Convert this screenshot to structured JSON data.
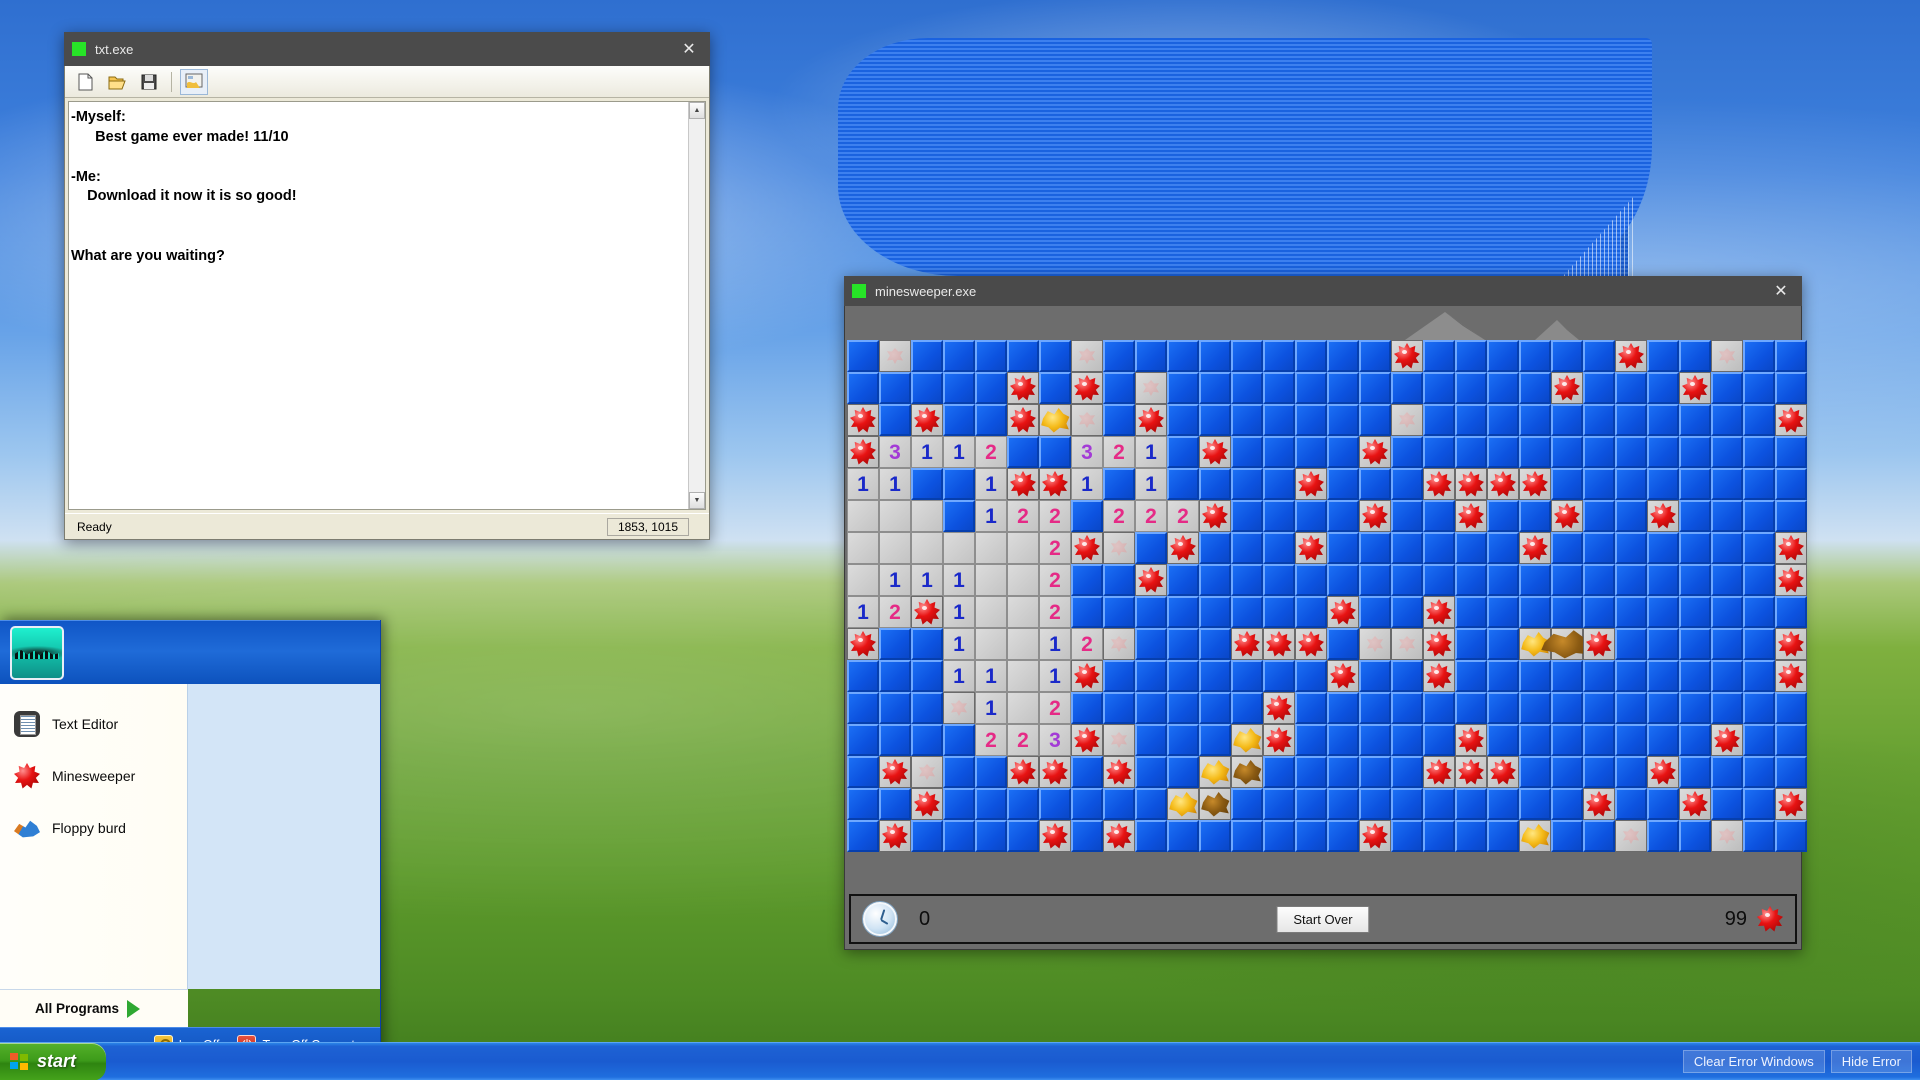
{
  "desktop": {
    "name": "windows-xp-bliss-wallpaper"
  },
  "text_editor": {
    "title": "txt.exe",
    "close_label": "✕",
    "toolbar": [
      {
        "name": "new-file-icon",
        "label": "New"
      },
      {
        "name": "open-file-icon",
        "label": "Open"
      },
      {
        "name": "save-file-icon",
        "label": "Save"
      },
      {
        "name": "run-script-icon",
        "label": "Run"
      }
    ],
    "content": "-Myself:\n      Best game ever made! 11/10\n\n-Me:\n    Download it now it is so good!\n\n\nWhat are you waiting?",
    "status_left": "Ready",
    "status_right": "1853, 1015"
  },
  "minesweeper": {
    "title": "minesweeper.exe",
    "close_label": "✕",
    "timer": "0",
    "mines_remaining": "99",
    "start_over_label": "Start Over",
    "clock_icon": "clock-icon",
    "mine_icon": "mine-icon",
    "grid": {
      "columns": 30,
      "rows": 16,
      "legend": {
        "h": "hidden-blue-tile",
        "o": "opened-empty-tile",
        "m": "revealed-mine",
        "f": "faint-flag-ghost",
        "b": "explosion-blob",
        "d": "dark-explosion-blob",
        "w": "wide-explosion-blob"
      },
      "cells": [
        [
          "h",
          "f",
          "h",
          "h",
          "h",
          "h",
          "h",
          "f",
          "h",
          "h",
          "h",
          "h",
          "h",
          "h",
          "h",
          "h",
          "h",
          "m",
          "h",
          "h",
          "h",
          "h",
          "h",
          "h",
          "m",
          "h",
          "h",
          "f",
          "h",
          "h"
        ],
        [
          "h",
          "h",
          "h",
          "h",
          "h",
          "m",
          "h",
          "m",
          "h",
          "f",
          "h",
          "h",
          "h",
          "h",
          "h",
          "h",
          "h",
          "h",
          "h",
          "h",
          "h",
          "h",
          "m",
          "h",
          "h",
          "h",
          "m",
          "h",
          "h",
          "h"
        ],
        [
          "m",
          "h",
          "m",
          "h",
          "h",
          "m",
          "b",
          "f",
          "h",
          "m",
          "h",
          "h",
          "h",
          "h",
          "h",
          "h",
          "h",
          "f",
          "h",
          "h",
          "h",
          "h",
          "h",
          "h",
          "h",
          "h",
          "h",
          "h",
          "h",
          "m"
        ],
        [
          "m",
          "3",
          "1",
          "1",
          "2",
          "h",
          "h",
          "3",
          "2",
          "1",
          "h",
          "m",
          "h",
          "h",
          "h",
          "h",
          "m",
          "h",
          "h",
          "h",
          "h",
          "h",
          "h",
          "h",
          "h",
          "h",
          "h",
          "h",
          "h",
          "h"
        ],
        [
          "1",
          "1",
          "h",
          "h",
          "1",
          "m",
          "m",
          "1",
          "h",
          "1",
          "h",
          "h",
          "h",
          "h",
          "m",
          "h",
          "h",
          "h",
          "m",
          "m",
          "m",
          "m",
          "h",
          "h",
          "h",
          "h",
          "h",
          "h",
          "h",
          "h"
        ],
        [
          "o",
          "o",
          "o",
          "h",
          "1",
          "2",
          "2",
          "h",
          "2",
          "2",
          "2",
          "m",
          "h",
          "h",
          "h",
          "h",
          "m",
          "h",
          "h",
          "m",
          "h",
          "h",
          "m",
          "h",
          "h",
          "m",
          "h",
          "h",
          "h",
          "h"
        ],
        [
          "o",
          "o",
          "o",
          "o",
          "o",
          "o",
          "2",
          "m",
          "f",
          "h",
          "m",
          "h",
          "h",
          "h",
          "m",
          "h",
          "h",
          "h",
          "h",
          "h",
          "h",
          "m",
          "h",
          "h",
          "h",
          "h",
          "h",
          "h",
          "h",
          "m"
        ],
        [
          "o",
          "1",
          "1",
          "1",
          "o",
          "o",
          "2",
          "h",
          "h",
          "m",
          "h",
          "h",
          "h",
          "h",
          "h",
          "h",
          "h",
          "h",
          "h",
          "h",
          "h",
          "h",
          "h",
          "h",
          "h",
          "h",
          "h",
          "h",
          "h",
          "m"
        ],
        [
          "1",
          "2",
          "m",
          "1",
          "o",
          "o",
          "2",
          "h",
          "h",
          "h",
          "h",
          "h",
          "h",
          "h",
          "h",
          "m",
          "h",
          "h",
          "m",
          "h",
          "h",
          "h",
          "h",
          "h",
          "h",
          "h",
          "h",
          "h",
          "h",
          "h"
        ],
        [
          "m",
          "h",
          "h",
          "1",
          "o",
          "o",
          "1",
          "2",
          "f",
          "h",
          "h",
          "h",
          "m",
          "m",
          "m",
          "h",
          "f",
          "f",
          "m",
          "h",
          "h",
          "b",
          "w",
          "m",
          "h",
          "h",
          "h",
          "h",
          "h",
          "m"
        ],
        [
          "h",
          "h",
          "h",
          "1",
          "1",
          "o",
          "1",
          "m",
          "h",
          "h",
          "h",
          "h",
          "h",
          "h",
          "h",
          "m",
          "h",
          "h",
          "m",
          "h",
          "h",
          "h",
          "h",
          "h",
          "h",
          "h",
          "h",
          "h",
          "h",
          "m"
        ],
        [
          "h",
          "h",
          "h",
          "f",
          "1",
          "o",
          "2",
          "h",
          "h",
          "h",
          "h",
          "h",
          "h",
          "m",
          "h",
          "h",
          "h",
          "h",
          "h",
          "h",
          "h",
          "h",
          "h",
          "h",
          "h",
          "h",
          "h",
          "h",
          "h",
          "h"
        ],
        [
          "h",
          "h",
          "h",
          "h",
          "2",
          "2",
          "3",
          "m",
          "f",
          "h",
          "h",
          "h",
          "b",
          "m",
          "h",
          "h",
          "h",
          "h",
          "h",
          "m",
          "h",
          "h",
          "h",
          "h",
          "h",
          "h",
          "h",
          "m",
          "h",
          "h"
        ],
        [
          "h",
          "m",
          "f",
          "h",
          "h",
          "m",
          "m",
          "h",
          "m",
          "h",
          "h",
          "b",
          "d",
          "h",
          "h",
          "h",
          "h",
          "h",
          "m",
          "m",
          "m",
          "h",
          "h",
          "h",
          "h",
          "m",
          "h",
          "h",
          "h",
          "h"
        ],
        [
          "h",
          "h",
          "m",
          "h",
          "h",
          "h",
          "h",
          "h",
          "h",
          "h",
          "b",
          "d",
          "h",
          "h",
          "h",
          "h",
          "h",
          "h",
          "h",
          "h",
          "h",
          "h",
          "h",
          "m",
          "h",
          "h",
          "m",
          "h",
          "h",
          "m"
        ],
        [
          "h",
          "m",
          "h",
          "h",
          "h",
          "h",
          "m",
          "h",
          "m",
          "h",
          "h",
          "h",
          "h",
          "h",
          "h",
          "h",
          "m",
          "h",
          "h",
          "h",
          "h",
          "b",
          "h",
          "h",
          "f",
          "h",
          "h",
          "f",
          "h",
          "h"
        ]
      ]
    }
  },
  "start_menu": {
    "avatar_name": "user-avatar",
    "items": [
      {
        "label": "Text Editor",
        "icon": "text-document-icon"
      },
      {
        "label": "Minesweeper",
        "icon": "mine-icon"
      },
      {
        "label": "Floppy burd",
        "icon": "bird-icon"
      }
    ],
    "all_programs_label": "All Programs",
    "log_off_label": "Log Off",
    "turn_off_label": "Turn Off Computer"
  },
  "taskbar": {
    "start_label": "start",
    "clear_error_windows_label": "Clear Error Windows",
    "hide_error_label": "Hide Error"
  },
  "colors": {
    "hidden_tile": "#0c52df",
    "taskbar_blue": "#1a5bd0",
    "start_green": "#3d9b1a",
    "mine_red": "#e81313",
    "window_chrome": "#4a4a4a"
  }
}
